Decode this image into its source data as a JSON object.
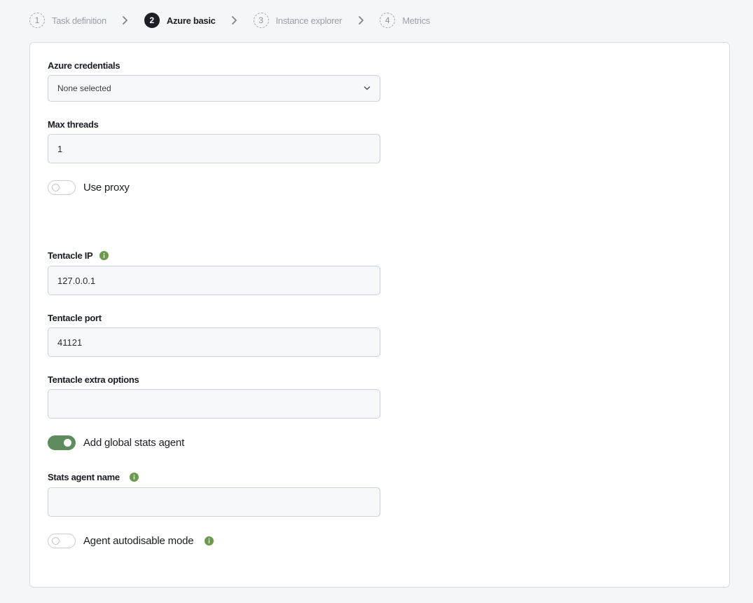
{
  "stepper": {
    "steps": [
      {
        "number": "1",
        "label": "Task definition",
        "state": "inactive"
      },
      {
        "number": "2",
        "label": "Azure basic",
        "state": "active"
      },
      {
        "number": "3",
        "label": "Instance explorer",
        "state": "inactive"
      },
      {
        "number": "4",
        "label": "Metrics",
        "state": "inactive"
      }
    ]
  },
  "form": {
    "azure_credentials": {
      "label": "Azure credentials",
      "value": "None selected"
    },
    "max_threads": {
      "label": "Max threads",
      "value": "1"
    },
    "use_proxy": {
      "label": "Use proxy",
      "checked": false
    },
    "tentacle_ip": {
      "label": "Tentacle IP",
      "value": "127.0.0.1"
    },
    "tentacle_port": {
      "label": "Tentacle port",
      "value": "41121"
    },
    "tentacle_extra_options": {
      "label": "Tentacle extra options",
      "value": ""
    },
    "add_global_stats_agent": {
      "label": "Add global stats agent",
      "checked": true
    },
    "stats_agent_name": {
      "label": "Stats agent name",
      "value": ""
    },
    "agent_autodisable_mode": {
      "label": "Agent autodisable mode",
      "checked": false
    }
  },
  "colors": {
    "accent_green": "#5f8c5f",
    "info_icon": "#6a9a4a",
    "active_step": "#1e1f26"
  },
  "icons": {
    "step_separator": "chevron-right-icon",
    "select_arrow": "chevron-down-icon",
    "info": "info-icon"
  }
}
